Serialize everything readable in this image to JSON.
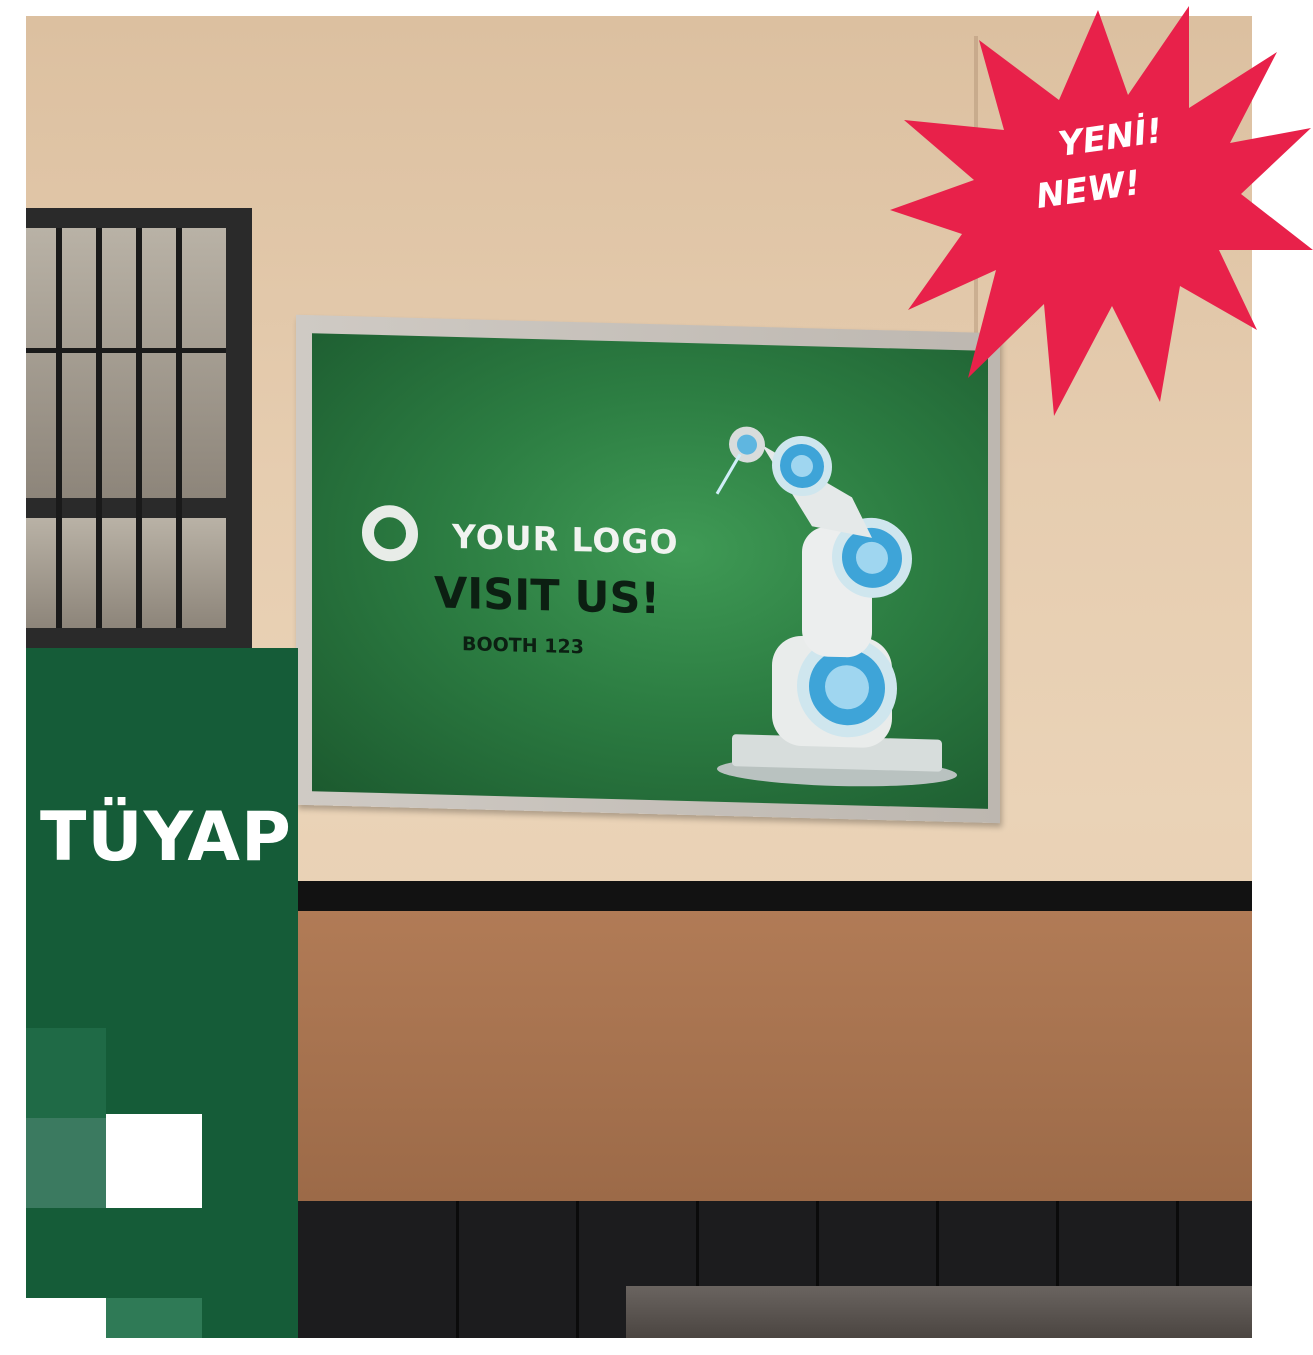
{
  "badge": {
    "line1": "YENİ!",
    "line2": "NEW!"
  },
  "billboard": {
    "logo_text": "YOUR LOGO",
    "headline": "VISIT US!",
    "booth": "BOOTH 123"
  },
  "booth_panel": {
    "brand": "TÜYAP"
  },
  "colors": {
    "badge": "#e8214a",
    "billboard_green": "#2c7d42",
    "booth_green": "#155c38"
  },
  "icons": [
    "logo-ring-icon",
    "robot-arm-image",
    "starburst-badge"
  ]
}
